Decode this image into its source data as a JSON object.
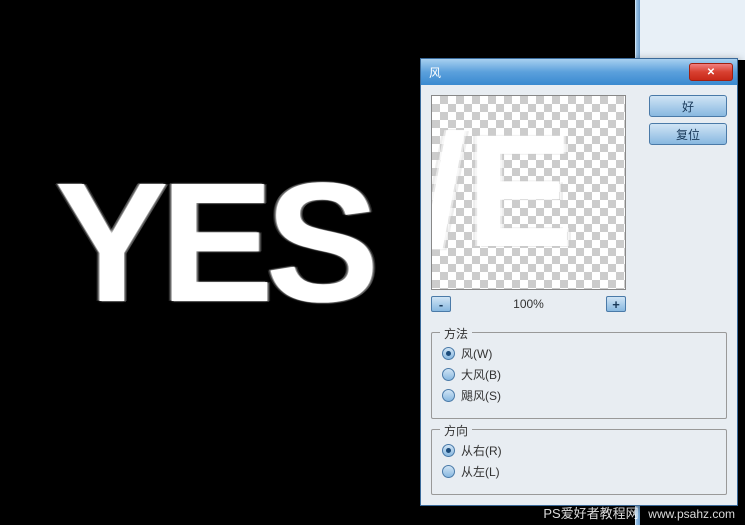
{
  "canvas": {
    "text": "YES",
    "preview_letter": "/E"
  },
  "dialog": {
    "title": "风",
    "ok_label": "好",
    "reset_label": "复位",
    "zoom": {
      "minus": "-",
      "plus": "+",
      "level": "100%"
    },
    "method": {
      "legend": "方法",
      "options": [
        {
          "label": "风(W)",
          "selected": true
        },
        {
          "label": "大风(B)",
          "selected": false
        },
        {
          "label": "飓风(S)",
          "selected": false
        }
      ]
    },
    "direction": {
      "legend": "方向",
      "options": [
        {
          "label": "从右(R)",
          "selected": true
        },
        {
          "label": "从左(L)",
          "selected": false
        }
      ]
    }
  },
  "watermark": {
    "text": "PS爱好者教程网",
    "url": "www.psahz.com"
  }
}
